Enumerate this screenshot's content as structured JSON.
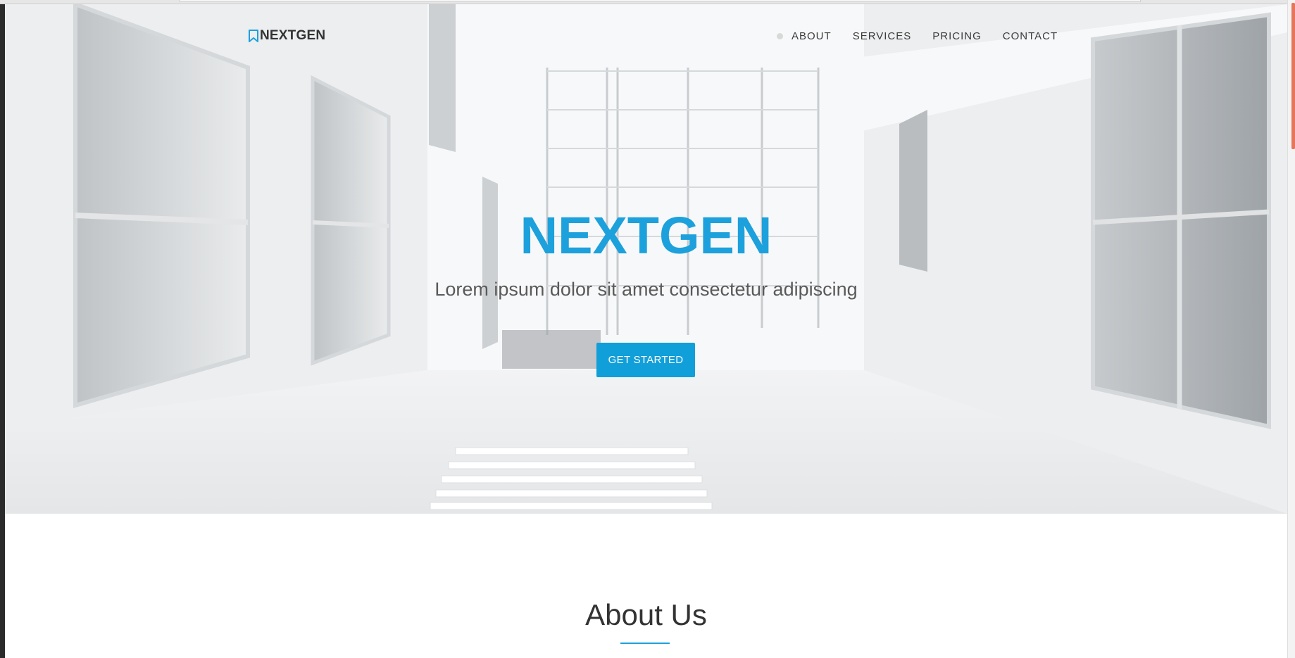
{
  "navbar": {
    "brand": "NEXTGEN",
    "items": [
      {
        "label": "ABOUT"
      },
      {
        "label": "SERVICES"
      },
      {
        "label": "PRICING"
      },
      {
        "label": "CONTACT"
      }
    ]
  },
  "hero": {
    "title": "NEXTGEN",
    "subtitle": "Lorem ipsum dolor sit amet consectetur adipiscing",
    "cta_label": "GET STARTED"
  },
  "about": {
    "title": "About Us"
  },
  "colors": {
    "accent": "#1ca1dc",
    "button": "#119fd9",
    "text_dark": "#333333",
    "scroll_thumb": "#e4765b"
  },
  "icons": {
    "brand": "bookmark-icon"
  }
}
